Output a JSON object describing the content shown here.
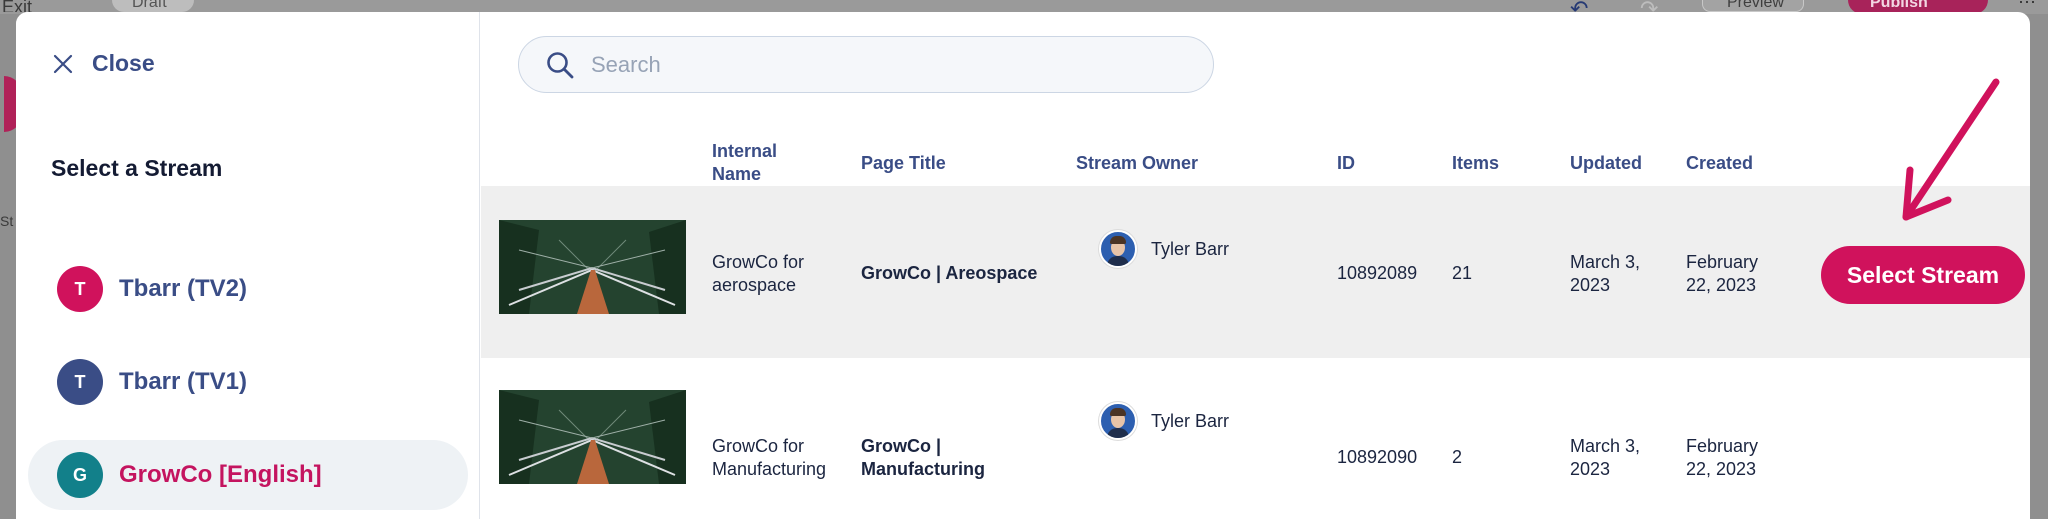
{
  "background": {
    "exit_label": "Exit",
    "draft_label": "Draft",
    "preview_label": "Preview",
    "publish_label": "Publish",
    "side_text": "St"
  },
  "sidebar": {
    "close_label": "Close",
    "title": "Select a Stream",
    "streams": [
      {
        "initial": "T",
        "label": "Tbarr (TV2)",
        "color": "#d0125c",
        "active": false
      },
      {
        "initial": "T",
        "label": "Tbarr (TV1)",
        "color": "#3a4d86",
        "active": false
      },
      {
        "initial": "G",
        "label": "GrowCo [English]",
        "color": "#12808a",
        "active": true
      }
    ]
  },
  "search": {
    "placeholder": "Search",
    "value": ""
  },
  "table": {
    "headers": {
      "internal_name_line1": "Internal",
      "internal_name_line2": "Name",
      "page_title": "Page Title",
      "stream_owner": "Stream Owner",
      "id": "ID",
      "items": "Items",
      "updated": "Updated",
      "created": "Created"
    },
    "rows": [
      {
        "internal_name_line1": "GrowCo for",
        "internal_name_line2": "aerospace",
        "page_title_line1": "GrowCo | Areospace",
        "page_title_line2": "",
        "owner": "Tyler Barr",
        "id": "10892089",
        "items": "21",
        "updated_line1": "March 3,",
        "updated_line2": "2023",
        "created_line1": "February",
        "created_line2": "22, 2023",
        "action_label": "Select Stream"
      },
      {
        "internal_name_line1": "GrowCo for",
        "internal_name_line2": "Manufacturing",
        "page_title_line1": "GrowCo |",
        "page_title_line2": "Manufacturing",
        "owner": "Tyler Barr",
        "id": "10892090",
        "items": "2",
        "updated_line1": "March 3,",
        "updated_line2": "2023",
        "created_line1": "February",
        "created_line2": "22, 2023"
      }
    ]
  },
  "colors": {
    "accent": "#d0125c",
    "nav_text": "#3a4d86",
    "selected_row_bg": "#efefef"
  }
}
